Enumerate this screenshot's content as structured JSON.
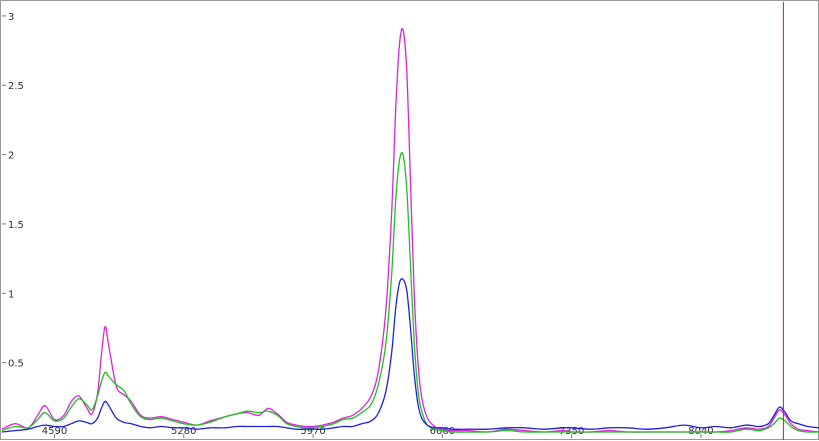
{
  "chart_data": {
    "type": "line",
    "title": "",
    "xlabel": "",
    "ylabel": "",
    "xlim": [
      4310,
      8670
    ],
    "ylim": [
      0,
      3.1
    ],
    "x_ticks": [
      {
        "value": 4590,
        "label": "4590"
      },
      {
        "value": 5280,
        "label": "5280"
      },
      {
        "value": 5970,
        "label": "5970"
      },
      {
        "value": 6660,
        "label": "6660"
      },
      {
        "value": 7350,
        "label": "7350"
      },
      {
        "value": 8040,
        "label": "8040"
      }
    ],
    "y_ticks": [
      {
        "value": 0.5,
        "label": "0.5"
      },
      {
        "value": 1,
        "label": "1"
      },
      {
        "value": 1.5,
        "label": "1.5"
      },
      {
        "value": 2,
        "label": "2"
      },
      {
        "value": 2.5,
        "label": "2.5"
      },
      {
        "value": 3,
        "label": "3"
      }
    ],
    "grid": false,
    "cursor_x": 8480,
    "series": [
      {
        "color": "#e020e0",
        "x": [
          4310,
          4380,
          4450,
          4500,
          4540,
          4590,
          4640,
          4680,
          4720,
          4760,
          4790,
          4820,
          4840,
          4860,
          4880,
          4920,
          4960,
          5000,
          5050,
          5100,
          5160,
          5220,
          5280,
          5350,
          5420,
          5500,
          5560,
          5620,
          5680,
          5730,
          5780,
          5830,
          5880,
          5930,
          5970,
          6020,
          6080,
          6130,
          6180,
          6230,
          6280,
          6320,
          6360,
          6390,
          6410,
          6430,
          6450,
          6470,
          6490,
          6510,
          6530,
          6550,
          6580,
          6620,
          6660,
          6720,
          6800,
          6900,
          7000,
          7100,
          7200,
          7300,
          7350,
          7450,
          7550,
          7650,
          7750,
          7850,
          7950,
          8040,
          8120,
          8200,
          8280,
          8350,
          8400,
          8430,
          8460,
          8490,
          8520,
          8560,
          8610,
          8670
        ],
        "y": [
          0.02,
          0.06,
          0.03,
          0.12,
          0.19,
          0.09,
          0.12,
          0.22,
          0.26,
          0.18,
          0.13,
          0.28,
          0.55,
          0.76,
          0.62,
          0.33,
          0.27,
          0.22,
          0.12,
          0.1,
          0.11,
          0.09,
          0.07,
          0.05,
          0.08,
          0.11,
          0.13,
          0.14,
          0.12,
          0.17,
          0.13,
          0.07,
          0.05,
          0.04,
          0.04,
          0.05,
          0.07,
          0.1,
          0.12,
          0.17,
          0.26,
          0.45,
          0.9,
          1.6,
          2.3,
          2.78,
          2.9,
          2.6,
          1.8,
          1.0,
          0.5,
          0.25,
          0.1,
          0.04,
          0.02,
          0.01,
          0.01,
          0.0,
          0.02,
          0.01,
          0.0,
          0.01,
          0.0,
          0.0,
          0.01,
          0.0,
          0.0,
          0.0,
          0.0,
          0.0,
          0.0,
          0.01,
          0.03,
          0.02,
          0.04,
          0.1,
          0.16,
          0.12,
          0.06,
          0.02,
          0.01,
          0.0
        ]
      },
      {
        "color": "#20c020",
        "x": [
          4310,
          4380,
          4450,
          4500,
          4540,
          4590,
          4640,
          4680,
          4720,
          4760,
          4790,
          4820,
          4840,
          4860,
          4880,
          4920,
          4960,
          5000,
          5050,
          5100,
          5160,
          5220,
          5280,
          5350,
          5420,
          5500,
          5560,
          5620,
          5680,
          5730,
          5780,
          5830,
          5880,
          5930,
          5970,
          6020,
          6080,
          6130,
          6180,
          6230,
          6280,
          6320,
          6360,
          6390,
          6410,
          6430,
          6450,
          6470,
          6490,
          6510,
          6530,
          6550,
          6580,
          6620,
          6660,
          6720,
          6800,
          6900,
          7000,
          7100,
          7200,
          7300,
          7350,
          7450,
          7550,
          7650,
          7750,
          7850,
          7950,
          8040,
          8120,
          8200,
          8280,
          8350,
          8400,
          8430,
          8460,
          8490,
          8520,
          8560,
          8610,
          8670
        ],
        "y": [
          0.01,
          0.04,
          0.03,
          0.09,
          0.14,
          0.08,
          0.1,
          0.18,
          0.24,
          0.2,
          0.16,
          0.26,
          0.36,
          0.43,
          0.4,
          0.34,
          0.3,
          0.2,
          0.11,
          0.09,
          0.1,
          0.08,
          0.06,
          0.05,
          0.07,
          0.11,
          0.13,
          0.15,
          0.14,
          0.15,
          0.12,
          0.06,
          0.04,
          0.03,
          0.03,
          0.04,
          0.06,
          0.09,
          0.1,
          0.14,
          0.2,
          0.35,
          0.65,
          1.15,
          1.65,
          1.95,
          2.0,
          1.75,
          1.2,
          0.65,
          0.3,
          0.15,
          0.05,
          0.02,
          0.01,
          0.0,
          0.0,
          0.0,
          0.01,
          0.0,
          0.0,
          0.0,
          0.0,
          0.0,
          0.0,
          0.0,
          0.0,
          0.0,
          0.0,
          0.0,
          0.0,
          0.0,
          0.02,
          0.01,
          0.03,
          0.06,
          0.1,
          0.08,
          0.04,
          0.01,
          0.0,
          0.0
        ]
      },
      {
        "color": "#2020e0",
        "x": [
          4310,
          4380,
          4450,
          4500,
          4540,
          4590,
          4640,
          4680,
          4720,
          4760,
          4790,
          4820,
          4840,
          4860,
          4880,
          4920,
          4960,
          5000,
          5050,
          5100,
          5160,
          5220,
          5280,
          5350,
          5420,
          5500,
          5560,
          5620,
          5680,
          5730,
          5780,
          5830,
          5880,
          5930,
          5970,
          6020,
          6080,
          6130,
          6180,
          6230,
          6280,
          6320,
          6360,
          6390,
          6410,
          6430,
          6450,
          6470,
          6490,
          6510,
          6530,
          6550,
          6580,
          6620,
          6660,
          6720,
          6800,
          6900,
          7000,
          7100,
          7200,
          7300,
          7350,
          7450,
          7550,
          7650,
          7750,
          7850,
          7950,
          8040,
          8120,
          8200,
          8280,
          8350,
          8400,
          8430,
          8460,
          8490,
          8520,
          8560,
          8610,
          8670
        ],
        "y": [
          0.0,
          0.01,
          0.02,
          0.04,
          0.05,
          0.04,
          0.04,
          0.06,
          0.08,
          0.07,
          0.06,
          0.1,
          0.17,
          0.22,
          0.19,
          0.1,
          0.07,
          0.06,
          0.04,
          0.03,
          0.04,
          0.03,
          0.03,
          0.02,
          0.03,
          0.03,
          0.04,
          0.04,
          0.04,
          0.04,
          0.04,
          0.03,
          0.02,
          0.02,
          0.02,
          0.02,
          0.03,
          0.04,
          0.04,
          0.06,
          0.08,
          0.14,
          0.3,
          0.58,
          0.88,
          1.07,
          1.1,
          1.02,
          0.75,
          0.42,
          0.2,
          0.1,
          0.05,
          0.03,
          0.03,
          0.02,
          0.02,
          0.02,
          0.03,
          0.03,
          0.02,
          0.03,
          0.03,
          0.02,
          0.03,
          0.03,
          0.02,
          0.03,
          0.05,
          0.03,
          0.04,
          0.03,
          0.05,
          0.04,
          0.06,
          0.12,
          0.18,
          0.14,
          0.08,
          0.06,
          0.04,
          0.03
        ]
      }
    ]
  }
}
